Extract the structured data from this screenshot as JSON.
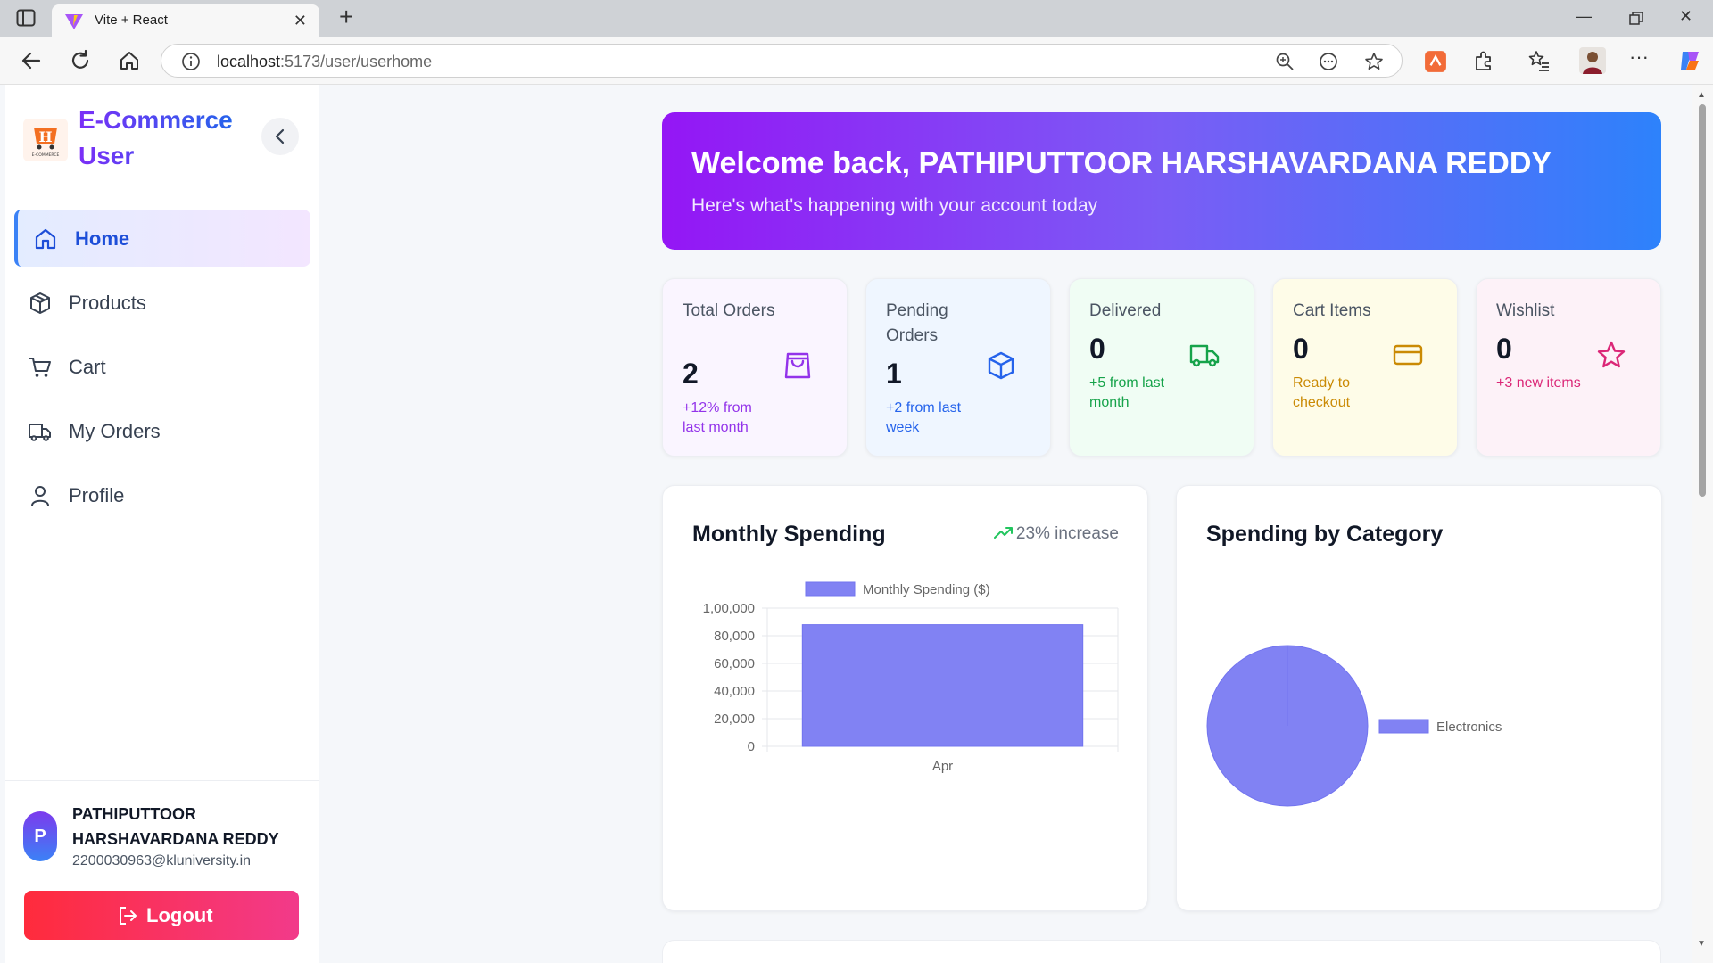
{
  "browser": {
    "tab_title": "Vite + React",
    "url_host": "localhost",
    "url_path": ":5173/user/userhome"
  },
  "sidebar": {
    "brand_line1": "E-Commerce",
    "brand_line2": "User",
    "logo_letter": "H",
    "logo_caption": "E-COMMERCE",
    "items": [
      {
        "label": "Home",
        "icon": "home-icon",
        "active": true
      },
      {
        "label": "Products",
        "icon": "package-icon",
        "active": false
      },
      {
        "label": "Cart",
        "icon": "cart-icon",
        "active": false
      },
      {
        "label": "My Orders",
        "icon": "truck-icon",
        "active": false
      },
      {
        "label": "Profile",
        "icon": "user-icon",
        "active": false
      }
    ],
    "user": {
      "initial": "P",
      "name": "PATHIPUTTOOR HARSHAVARDANA REDDY",
      "email": "2200030963@kluniversity.in"
    },
    "logout_label": "Logout"
  },
  "banner": {
    "title": "Welcome back, PATHIPUTTOOR HARSHAVARDANA REDDY",
    "subtitle": "Here's what's happening with your account today"
  },
  "stats": [
    {
      "label": "Total Orders",
      "value": "2",
      "note": "+12% from last month",
      "icon": "shopping-bag-icon",
      "bg": "#faf5ff",
      "accent": "#9333ea"
    },
    {
      "label": "Pending Orders",
      "value": "1",
      "note": "+2 from last week",
      "icon": "box-icon",
      "bg": "#eff6ff",
      "accent": "#2563eb"
    },
    {
      "label": "Delivered",
      "value": "0",
      "note": "+5 from last month",
      "icon": "truck-icon",
      "bg": "#f0fdf4",
      "accent": "#16a34a"
    },
    {
      "label": "Cart Items",
      "value": "0",
      "note": "Ready to checkout",
      "icon": "credit-card-icon",
      "bg": "#fefce8",
      "accent": "#ca8a04"
    },
    {
      "label": "Wishlist",
      "value": "0",
      "note": "+3 new items",
      "icon": "star-icon",
      "bg": "#fdf2f8",
      "accent": "#db2777"
    }
  ],
  "monthly_card": {
    "title": "Monthly Spending",
    "trend": "23% increase"
  },
  "category_card": {
    "title": "Spending by Category"
  },
  "chart_data": [
    {
      "type": "bar",
      "categories": [
        "Apr"
      ],
      "series": [
        {
          "name": "Monthly Spending ($)",
          "values": [
            88000
          ]
        }
      ],
      "ylim": [
        0,
        100000
      ],
      "yticks": [
        "0",
        "20,000",
        "40,000",
        "60,000",
        "80,000",
        "1,00,000"
      ],
      "legend": "top",
      "grid": true,
      "color": "#8182f3"
    },
    {
      "type": "pie",
      "labels": [
        "Electronics"
      ],
      "values": [
        100
      ],
      "legend": "right",
      "color": "#8182f3"
    }
  ]
}
